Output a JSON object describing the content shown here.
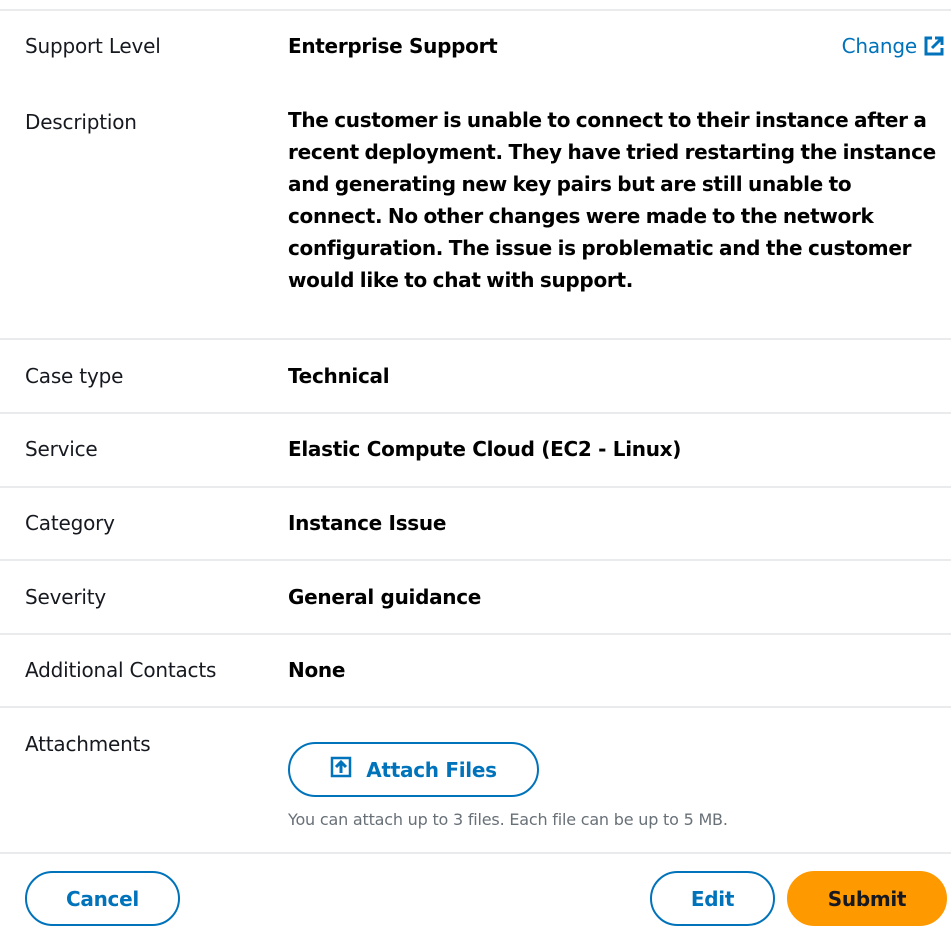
{
  "support_level": {
    "label": "Support Level",
    "value": "Enterprise Support",
    "change_link": "Change",
    "change_icon": "external-link-icon"
  },
  "description": {
    "label": "Description",
    "value": "The customer is unable to connect to their instance after a recent deployment. They have tried restarting the instance and generating new key pairs but are still unable to connect. No other changes were made to the network configuration. The issue is problematic and the customer would like to chat with support."
  },
  "case_type": {
    "label": "Case type",
    "value": "Technical"
  },
  "service": {
    "label": "Service",
    "value": "Elastic Compute Cloud (EC2 - Linux)"
  },
  "category": {
    "label": "Category",
    "value": "Instance Issue"
  },
  "severity": {
    "label": "Severity",
    "value": "General guidance"
  },
  "additional_contacts": {
    "label": "Additional Contacts",
    "value": "None"
  },
  "attachments": {
    "label": "Attachments",
    "button_label": "Attach Files",
    "button_icon": "upload-icon",
    "hint": "You can attach up to 3 files. Each file can be up to 5 MB."
  },
  "actions": {
    "cancel_label": "Cancel",
    "edit_label": "Edit",
    "submit_label": "Submit"
  },
  "colors": {
    "link": "#0073bb",
    "primary_button": "#ff9900",
    "divider": "#e9ebed",
    "hint_text": "#687078"
  }
}
